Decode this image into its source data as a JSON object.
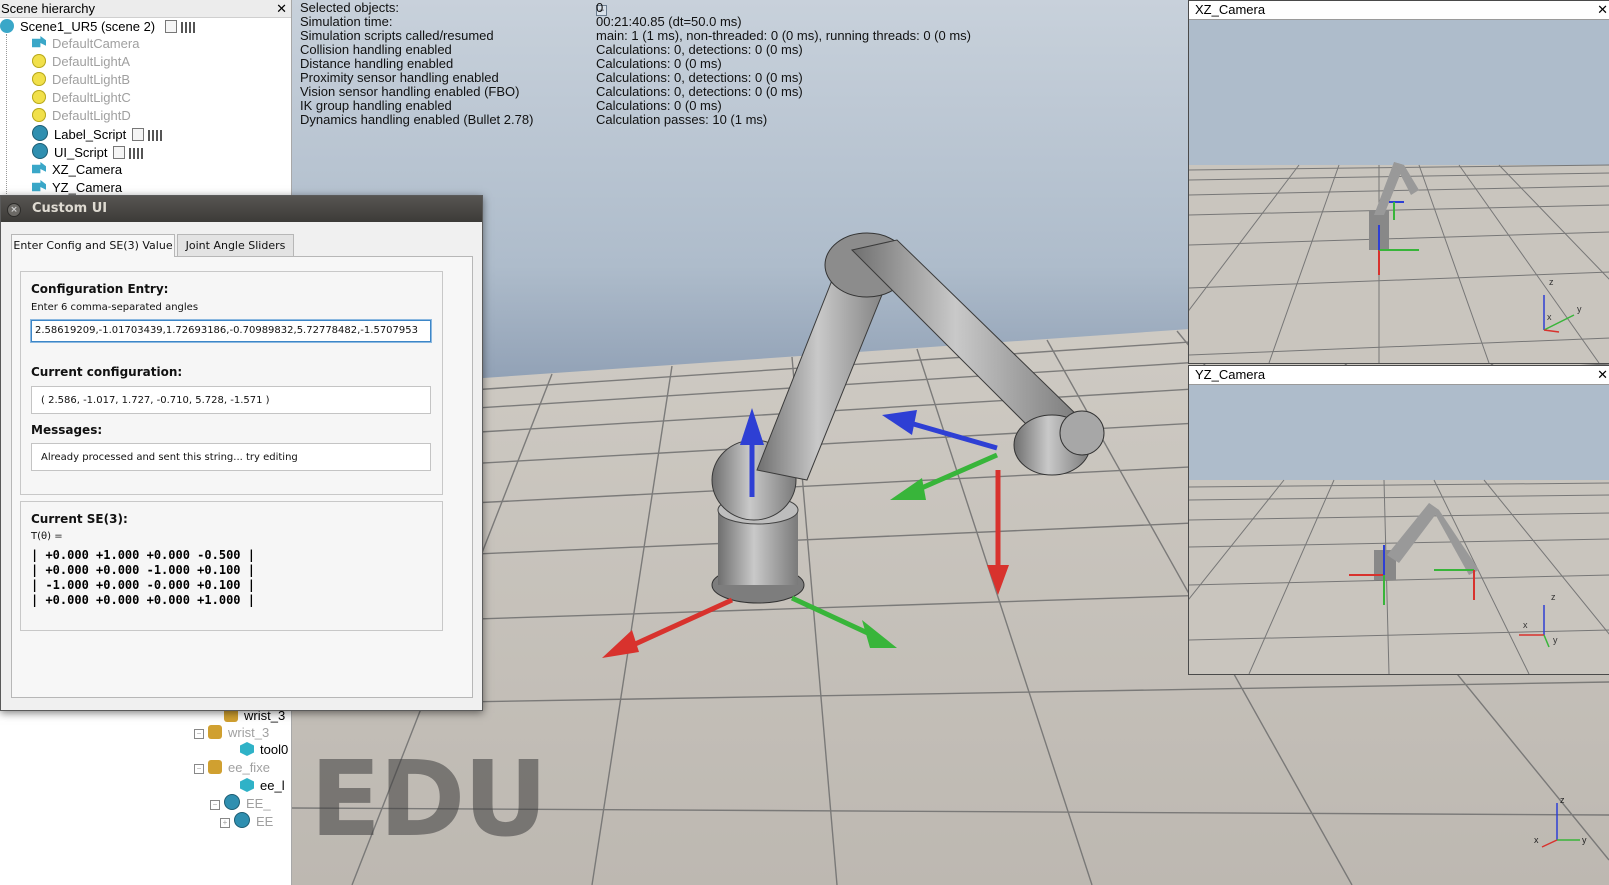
{
  "hierarchy": {
    "title": "Scene hierarchy",
    "close": "✕",
    "scene_name": "Scene1_UR5 (scene 2)",
    "items": [
      {
        "label": "DefaultCamera",
        "icon": "camera-icon",
        "dim": true
      },
      {
        "label": "DefaultLightA",
        "icon": "light-icon",
        "dim": true
      },
      {
        "label": "DefaultLightB",
        "icon": "light-icon",
        "dim": true
      },
      {
        "label": "DefaultLightC",
        "icon": "light-icon",
        "dim": true
      },
      {
        "label": "DefaultLightD",
        "icon": "light-icon",
        "dim": true
      },
      {
        "label": "Label_Script",
        "icon": "script-icon",
        "dim": false
      },
      {
        "label": "UI_Script",
        "icon": "script-icon",
        "dim": false
      },
      {
        "label": "XZ_Camera",
        "icon": "camera-icon",
        "dim": false
      },
      {
        "label": "YZ_Camera",
        "icon": "camera-icon",
        "dim": false
      }
    ],
    "lower_items": [
      {
        "label": "wrist_3",
        "dim": false
      },
      {
        "label": "wrist_3",
        "dim": true
      },
      {
        "label": "tool0",
        "dim": false
      },
      {
        "label": "ee_fixe",
        "dim": true
      },
      {
        "label": "ee_l",
        "dim": false
      },
      {
        "label": "EE_",
        "dim": true
      },
      {
        "label": "EE",
        "dim": true
      }
    ]
  },
  "info": {
    "rows": [
      {
        "label": "Selected objects:",
        "value": "0"
      },
      {
        "label": "Simulation time:",
        "value": "00:21:40.85 (dt=50.0 ms)"
      },
      {
        "label": "Simulation scripts called/resumed",
        "value": "main: 1 (1 ms), non-threaded: 0 (0 ms), running threads: 0 (0 ms)"
      },
      {
        "label": "Collision handling enabled",
        "value": "Calculations: 0, detections: 0 (0 ms)"
      },
      {
        "label": "Distance handling enabled",
        "value": "Calculations: 0 (0 ms)"
      },
      {
        "label": "Proximity sensor handling enabled",
        "value": "Calculations: 0, detections: 0 (0 ms)"
      },
      {
        "label": "Vision sensor handling enabled (FBO)",
        "value": "Calculations: 0, detections: 0 (0 ms)"
      },
      {
        "label": "IK group handling enabled",
        "value": "Calculations: 0 (0 ms)"
      },
      {
        "label": "Dynamics handling enabled (Bullet 2.78)",
        "value": "Calculation passes: 10 (1 ms)"
      }
    ]
  },
  "watermark": "EDU",
  "cameras": {
    "xz_title": "XZ_Camera",
    "yz_title": "YZ_Camera",
    "close": "✕"
  },
  "dialog": {
    "title": "Custom UI",
    "tabs": [
      "Enter Config and SE(3) Value",
      "Joint Angle Sliders"
    ],
    "config_entry_heading": "Configuration Entry:",
    "config_entry_hint": "Enter 6 comma-separated angles",
    "config_input_value": "2.58619209,-1.01703439,1.72693186,-0.70989832,5.72778482,-1.5707953",
    "current_config_heading": "Current configuration:",
    "current_config_value": "( 2.586, -1.017,  1.727, -0.710,  5.728, -1.571  )",
    "messages_heading": "Messages:",
    "messages_value": "Already processed and sent this string... try editing",
    "se3_heading": "Current SE(3):",
    "se3_prefix": "T(θ) =",
    "se3_rows": [
      "| +0.000 +1.000 +0.000 -0.500 |",
      "| +0.000 +0.000 -1.000 +0.100 |",
      "| -1.000 +0.000 -0.000 +0.100 |",
      "| +0.000 +0.000 +0.000 +1.000 |"
    ]
  },
  "colors": {
    "axis_x": "#d8322d",
    "axis_y": "#38b53a",
    "axis_z": "#2e3fd4",
    "robot": "#9a9a9a",
    "dialog_title_bar": "#4a4845"
  }
}
